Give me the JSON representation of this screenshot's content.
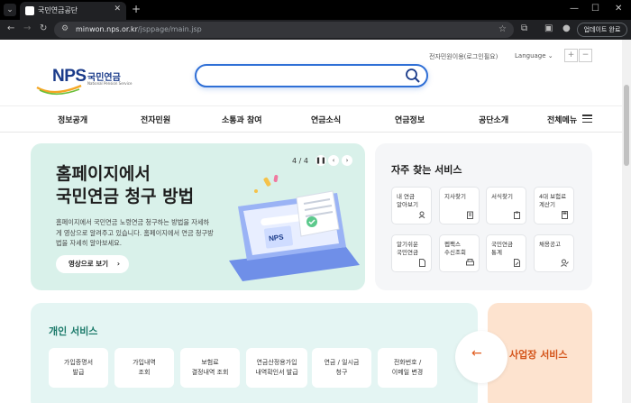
{
  "browser": {
    "tab_title": "국민연금공단",
    "url_host": "minwon.nps.or.kr",
    "url_path": "/jsppage/main.jsp",
    "update_label": "업데이트 완료"
  },
  "header": {
    "logo_text": "NPS",
    "logo_kr": "국민연금",
    "logo_en": "National Pension Service",
    "util_link": "전자민원이용(로그인필요)",
    "language": "Language",
    "zoom_in": "+",
    "zoom_out": "−"
  },
  "gnb": [
    "정보공개",
    "전자민원",
    "소통과 참여",
    "연금소식",
    "연금정보",
    "공단소개",
    "전체메뉴"
  ],
  "hero": {
    "title_line1": "홈페이지에서",
    "title_line2": "국민연금 청구 방법",
    "desc": "홈페이지에서 국민연금 노령연금 청구하는 방법을 자세하게 영상으로 알려주고 있습니다. 홈페이지에서 연금 청구방법을 자세히 알아보세요.",
    "button": "영상으로 보기",
    "pager": "4 / 4"
  },
  "frequent": {
    "title": "자주 찾는 서비스",
    "tiles": [
      {
        "label1": "내 연금",
        "label2": "알아보기"
      },
      {
        "label1": "지사찾기",
        "label2": ""
      },
      {
        "label1": "서식찾기",
        "label2": ""
      },
      {
        "label1": "4대 보험료",
        "label2": "계산기"
      },
      {
        "label1": "알기쉬운",
        "label2": "국민연금"
      },
      {
        "label1": "펩팩스",
        "label2": "수신조회"
      },
      {
        "label1": "국민연금",
        "label2": "통계"
      },
      {
        "label1": "채용공고",
        "label2": ""
      }
    ]
  },
  "personal": {
    "title": "개인 서비스",
    "buttons": [
      {
        "line1": "가입증명서",
        "line2": "발급"
      },
      {
        "line1": "가입내역",
        "line2": "조회"
      },
      {
        "line1": "보험료",
        "line2": "결정내역 조회"
      },
      {
        "line1": "연금산정용가입",
        "line2": "내역확인서 발급"
      },
      {
        "line1": "연금 / 일시금",
        "line2": "청구"
      },
      {
        "line1": "전화번호 /",
        "line2": "이메일 변경"
      }
    ]
  },
  "business": {
    "label": "사업장 서비스"
  },
  "colors": {
    "brand_blue": "#1a3b8a",
    "search_blue": "#2f6fd6",
    "hero_bg": "#d9f1ea",
    "personal_bg": "#e4f5f3",
    "personal_title": "#1b7a6a",
    "business_bg": "#fde3cf",
    "business_text": "#d4541a"
  }
}
